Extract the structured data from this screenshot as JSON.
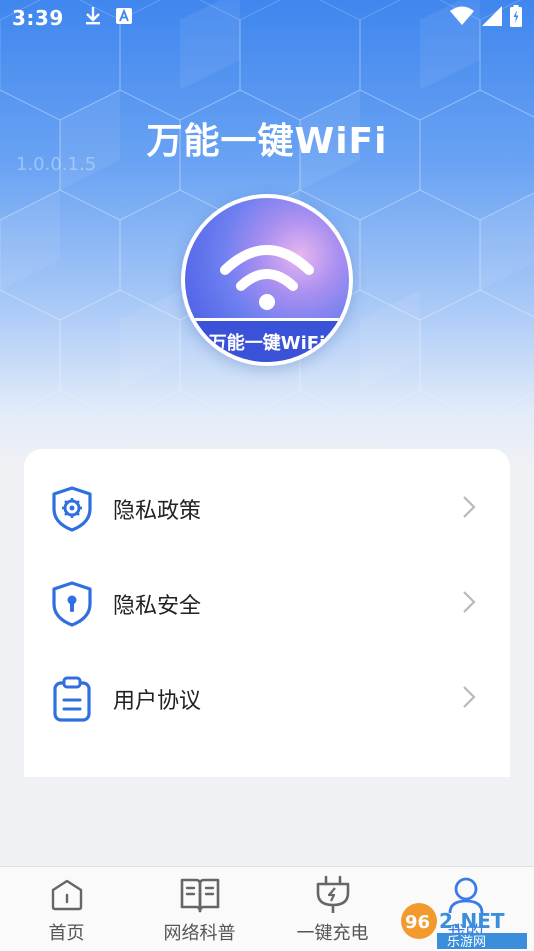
{
  "status_bar": {
    "time": "3:39",
    "icons": [
      "download-icon",
      "text-a-icon",
      "wifi-signal-icon",
      "cell-signal-icon",
      "battery-icon"
    ]
  },
  "header": {
    "title": "万能一键WiFi",
    "version": "1.0.0.1.5",
    "logo_text": "万能一键WiFi"
  },
  "menu": {
    "items": [
      {
        "label": "隐私政策",
        "icon": "shield-gear-icon"
      },
      {
        "label": "隐私安全",
        "icon": "shield-lock-icon"
      },
      {
        "label": "用户协议",
        "icon": "clipboard-icon"
      }
    ]
  },
  "tabs": [
    {
      "label": "首页",
      "icon": "home-icon"
    },
    {
      "label": "网络科普",
      "icon": "book-icon"
    },
    {
      "label": "一键充电",
      "icon": "charger-icon"
    },
    {
      "label": "我的",
      "icon": "user-icon"
    }
  ],
  "watermark": {
    "brand": "962.NET",
    "sub": "乐游网"
  },
  "colors": {
    "accent": "#3a7bea",
    "icon_blue": "#2f6fe0",
    "hero_top": "#3f86ee"
  }
}
